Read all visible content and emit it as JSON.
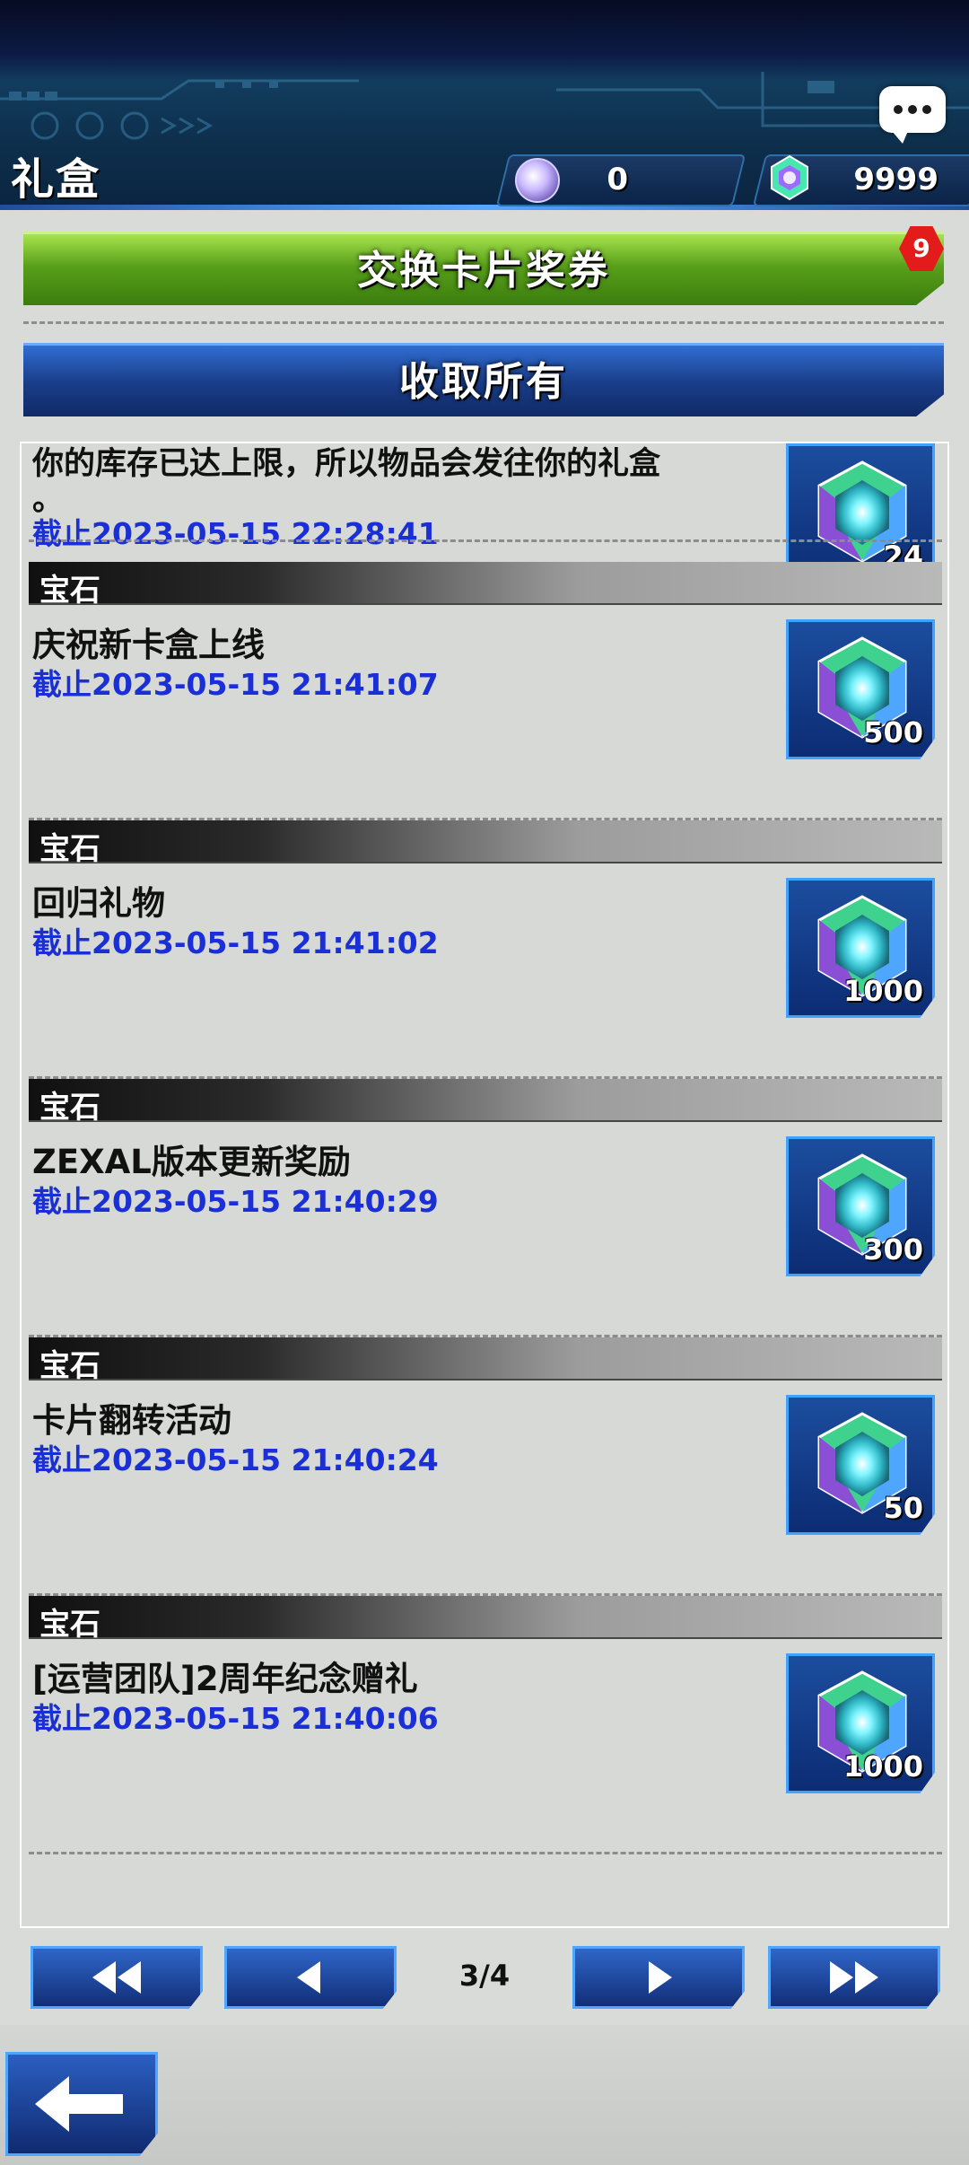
{
  "header": {
    "title": "礼盒",
    "chat_icon": "chat-bubble-icon",
    "currencies": [
      {
        "icon": "orb-icon",
        "value": "0"
      },
      {
        "icon": "gem-icon",
        "value": "9999"
      }
    ]
  },
  "actions": {
    "exchange_label": "交换卡片奖券",
    "exchange_badge": "9",
    "collect_all_label": "收取所有"
  },
  "list": {
    "partial_item": {
      "text_line": "你的库存已达上限，所以物品会发往你的礼盒",
      "text_tail": "。",
      "expiry": "截止2023-05-15 22:28:41",
      "count": "24"
    },
    "items": [
      {
        "category": "宝石",
        "title": "庆祝新卡盒上线",
        "expiry": "截止2023-05-15 21:41:07",
        "count": "500"
      },
      {
        "category": "宝石",
        "title": "回归礼物",
        "expiry": "截止2023-05-15 21:41:02",
        "count": "1000"
      },
      {
        "category": "宝石",
        "title": "ZEXAL版本更新奖励",
        "expiry": "截止2023-05-15 21:40:29",
        "count": "300"
      },
      {
        "category": "宝石",
        "title": "卡片翻转活动",
        "expiry": "截止2023-05-15 21:40:24",
        "count": "50"
      },
      {
        "category": "宝石",
        "title": "[运营团队]2周年纪念赠礼",
        "expiry": "截止2023-05-15 21:40:06",
        "count": "1000"
      }
    ]
  },
  "pager": {
    "indicator": "3/4",
    "first_icon": "double-chevron-left-icon",
    "prev_icon": "chevron-left-icon",
    "next_icon": "chevron-right-icon",
    "last_icon": "double-chevron-right-icon"
  },
  "footer": {
    "back_icon": "back-arrow-icon"
  },
  "colors": {
    "expiry": "#1a2fd6",
    "exchange": "#4f9a18",
    "primary_blue": "#1b3f8c"
  }
}
